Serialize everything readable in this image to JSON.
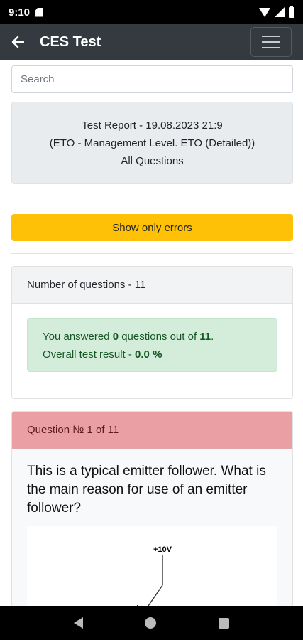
{
  "status_bar": {
    "time": "9:10"
  },
  "app_bar": {
    "title": "CES Test"
  },
  "search": {
    "placeholder": "Search"
  },
  "report": {
    "line1": "Test Report - 19.08.2023 21:9",
    "line2": "(ETO - Management Level. ETO (Detailed))",
    "line3": "All Questions"
  },
  "errors_button": {
    "label": "Show only errors"
  },
  "summary": {
    "header": "Number of questions - 11",
    "answered_prefix": "You answered ",
    "answered_count": "0",
    "answered_middle": " questions out of ",
    "total": "11",
    "answered_suffix": ".",
    "result_prefix": "Overall test result - ",
    "result_value": "0.0 %"
  },
  "question": {
    "header": "Question № 1 of 11",
    "text": "This is a typical emitter follower. What is the main reason for use of an emitter follower?",
    "diagram_label": "+10V"
  },
  "colors": {
    "app_bar": "#343a40",
    "warning": "#ffc107",
    "success_bg": "#d4edda",
    "success_text": "#155724",
    "danger_header": "#ea9fa5"
  },
  "icons": {
    "back": "arrow-left-icon",
    "menu": "hamburger-icon",
    "nav_back": "triangle-back-icon",
    "nav_home": "circle-home-icon",
    "nav_recent": "square-recents-icon"
  }
}
